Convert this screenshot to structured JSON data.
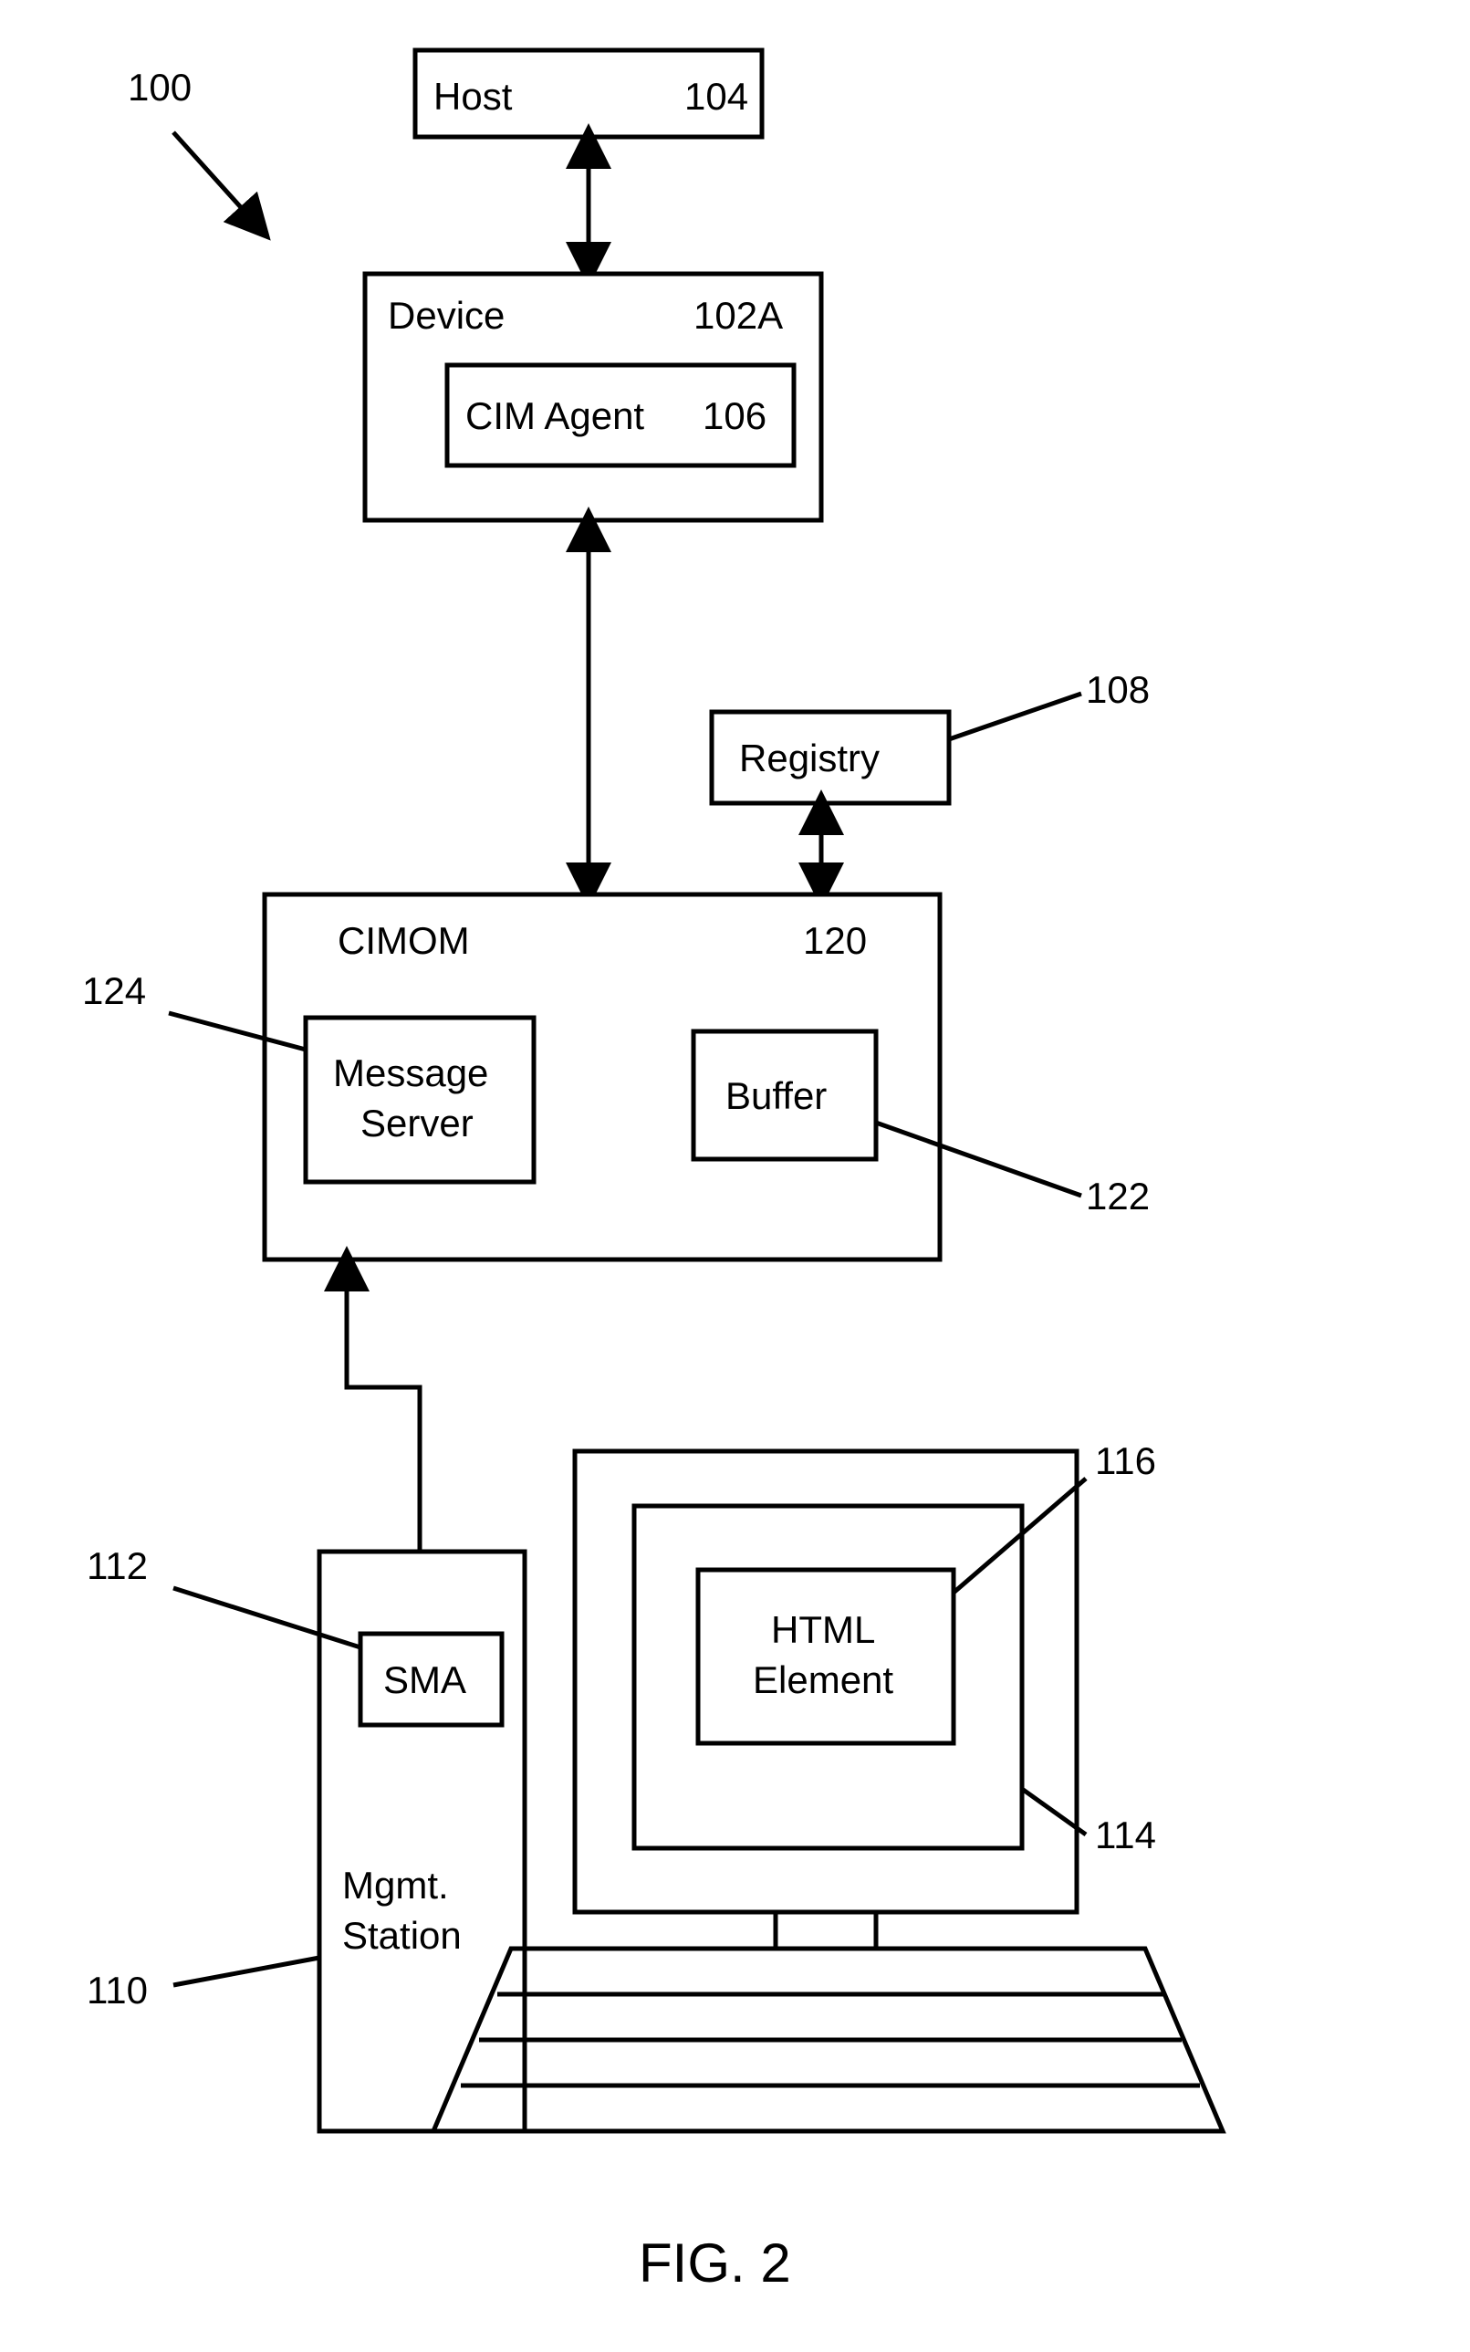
{
  "figure": {
    "caption": "FIG. 2",
    "system_ref": "100",
    "host": {
      "label": "Host",
      "ref": "104"
    },
    "device": {
      "label": "Device",
      "ref": "102A"
    },
    "cim_agent": {
      "label": "CIM Agent",
      "ref": "106"
    },
    "registry": {
      "label": "Registry",
      "ref": "108"
    },
    "cimom": {
      "label": "CIMOM",
      "ref": "120"
    },
    "message_server": {
      "label_line1": "Message",
      "label_line2": "Server",
      "ref": "124"
    },
    "buffer": {
      "label": "Buffer",
      "ref": "122"
    },
    "sma": {
      "label": "SMA",
      "ref": "112"
    },
    "mgmt_station": {
      "label_line1": "Mgmt.",
      "label_line2": "Station",
      "ref": "110"
    },
    "html_element": {
      "label_line1": "HTML",
      "label_line2": "Element",
      "ref": "116"
    },
    "display": {
      "ref": "114"
    }
  }
}
